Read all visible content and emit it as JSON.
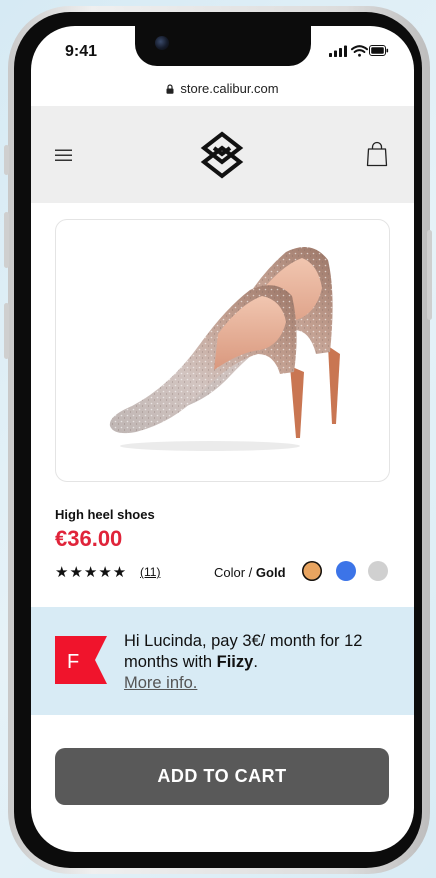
{
  "status_bar": {
    "time": "9:41"
  },
  "browser": {
    "url": "store.calibur.com"
  },
  "header": {
    "menu_icon": "hamburger-icon",
    "logo_icon": "calibur-logo",
    "cart_icon": "shopping-bag-icon"
  },
  "product": {
    "name": "High heel shoes",
    "price": "€36.00",
    "rating_stars": "★★★★★",
    "rating": 5,
    "review_count": "(11)",
    "color_label": "Color / ",
    "selected_color": "Gold",
    "swatches": [
      "#e8a460",
      "#3c74e8",
      "#d0d0d0"
    ]
  },
  "financing": {
    "logo_letter": "F",
    "text_before": "Hi Lucinda, pay 3€/ month for 12 months with ",
    "brand": "Fiizy",
    "text_after": ".",
    "link": "More info."
  },
  "actions": {
    "add_to_cart": "ADD TO CART"
  },
  "colors": {
    "price": "#e0243a",
    "fiizy_red": "#f0142c",
    "banner_bg": "#d8ebf5",
    "header_bg": "#eeeeee",
    "button_bg": "#595959"
  }
}
